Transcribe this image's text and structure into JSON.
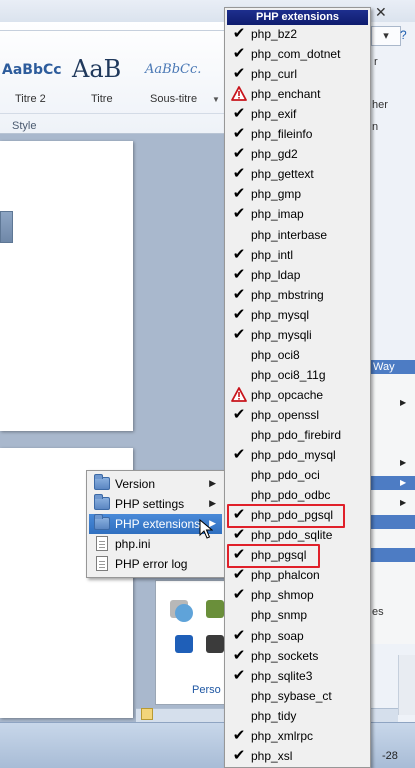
{
  "ribbon": {
    "styles": [
      {
        "sample": "AaBbCc",
        "label": "Titre 2"
      },
      {
        "sample": "AaB",
        "label": "Titre"
      },
      {
        "sample": "AaBbCc.",
        "label": "Sous-titre"
      }
    ],
    "group_label": "Style"
  },
  "right_side": {
    "way_label": "Way",
    "partial_texts": [
      "r",
      "her",
      "n",
      "es"
    ]
  },
  "tray": {
    "text": "Perso"
  },
  "taskbar": {
    "time_fragment": "-28"
  },
  "context_menu": {
    "items": [
      {
        "label": "Version",
        "icon": "folder-icon",
        "submenu": true,
        "active": false
      },
      {
        "label": "PHP settings",
        "icon": "folder-icon",
        "submenu": true,
        "active": false
      },
      {
        "label": "PHP extensions",
        "icon": "folder-icon",
        "submenu": true,
        "active": true
      },
      {
        "label": "php.ini",
        "icon": "file-icon",
        "submenu": false,
        "active": false
      },
      {
        "label": "PHP error log",
        "icon": "file-icon",
        "submenu": false,
        "active": false
      }
    ]
  },
  "extensions_menu": {
    "title": "PHP extensions",
    "highlight_color": "#e0202a",
    "items": [
      {
        "name": "php_bz2",
        "status": "checked"
      },
      {
        "name": "php_com_dotnet",
        "status": "checked"
      },
      {
        "name": "php_curl",
        "status": "checked"
      },
      {
        "name": "php_enchant",
        "status": "warning"
      },
      {
        "name": "php_exif",
        "status": "checked"
      },
      {
        "name": "php_fileinfo",
        "status": "checked"
      },
      {
        "name": "php_gd2",
        "status": "checked"
      },
      {
        "name": "php_gettext",
        "status": "checked"
      },
      {
        "name": "php_gmp",
        "status": "checked"
      },
      {
        "name": "php_imap",
        "status": "checked"
      },
      {
        "name": "php_interbase",
        "status": "none"
      },
      {
        "name": "php_intl",
        "status": "checked"
      },
      {
        "name": "php_ldap",
        "status": "checked"
      },
      {
        "name": "php_mbstring",
        "status": "checked"
      },
      {
        "name": "php_mysql",
        "status": "checked"
      },
      {
        "name": "php_mysqli",
        "status": "checked"
      },
      {
        "name": "php_oci8",
        "status": "none"
      },
      {
        "name": "php_oci8_11g",
        "status": "none"
      },
      {
        "name": "php_opcache",
        "status": "warning"
      },
      {
        "name": "php_openssl",
        "status": "checked"
      },
      {
        "name": "php_pdo_firebird",
        "status": "none"
      },
      {
        "name": "php_pdo_mysql",
        "status": "checked"
      },
      {
        "name": "php_pdo_oci",
        "status": "none"
      },
      {
        "name": "php_pdo_odbc",
        "status": "none"
      },
      {
        "name": "php_pdo_pgsql",
        "status": "checked",
        "highlighted": true
      },
      {
        "name": "php_pdo_sqlite",
        "status": "checked"
      },
      {
        "name": "php_pgsql",
        "status": "checked",
        "highlighted": true
      },
      {
        "name": "php_phalcon",
        "status": "checked"
      },
      {
        "name": "php_shmop",
        "status": "checked"
      },
      {
        "name": "php_snmp",
        "status": "none"
      },
      {
        "name": "php_soap",
        "status": "checked"
      },
      {
        "name": "php_sockets",
        "status": "checked"
      },
      {
        "name": "php_sqlite3",
        "status": "checked"
      },
      {
        "name": "php_sybase_ct",
        "status": "none"
      },
      {
        "name": "php_tidy",
        "status": "none"
      },
      {
        "name": "php_xmlrpc",
        "status": "checked"
      },
      {
        "name": "php_xsl",
        "status": "checked"
      }
    ]
  }
}
